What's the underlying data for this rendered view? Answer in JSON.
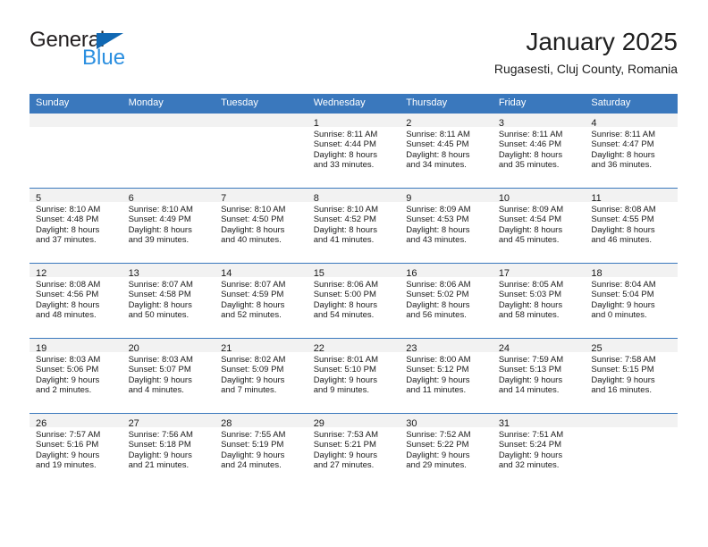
{
  "brand": {
    "name_top": "General",
    "name_bottom": "Blue",
    "triangle_color": "#1168b3",
    "blue_text_color": "#2b8fe0"
  },
  "header": {
    "title": "January 2025",
    "subtitle": "Rugasesti, Cluj County, Romania"
  },
  "theme": {
    "header_blue": "#3a78bd",
    "day_band_gray": "#f2f2f2",
    "text_color": "#1a1a1a"
  },
  "weekday_headers": [
    "Sunday",
    "Monday",
    "Tuesday",
    "Wednesday",
    "Thursday",
    "Friday",
    "Saturday"
  ],
  "weeks": [
    [
      {
        "day": "",
        "empty": true,
        "l1": "",
        "l2": "",
        "l3": "",
        "l4": ""
      },
      {
        "day": "",
        "empty": true,
        "l1": "",
        "l2": "",
        "l3": "",
        "l4": ""
      },
      {
        "day": "",
        "empty": true,
        "l1": "",
        "l2": "",
        "l3": "",
        "l4": ""
      },
      {
        "day": "1",
        "empty": false,
        "l1": "Sunrise: 8:11 AM",
        "l2": "Sunset: 4:44 PM",
        "l3": "Daylight: 8 hours",
        "l4": "and 33 minutes."
      },
      {
        "day": "2",
        "empty": false,
        "l1": "Sunrise: 8:11 AM",
        "l2": "Sunset: 4:45 PM",
        "l3": "Daylight: 8 hours",
        "l4": "and 34 minutes."
      },
      {
        "day": "3",
        "empty": false,
        "l1": "Sunrise: 8:11 AM",
        "l2": "Sunset: 4:46 PM",
        "l3": "Daylight: 8 hours",
        "l4": "and 35 minutes."
      },
      {
        "day": "4",
        "empty": false,
        "l1": "Sunrise: 8:11 AM",
        "l2": "Sunset: 4:47 PM",
        "l3": "Daylight: 8 hours",
        "l4": "and 36 minutes."
      }
    ],
    [
      {
        "day": "5",
        "empty": false,
        "l1": "Sunrise: 8:10 AM",
        "l2": "Sunset: 4:48 PM",
        "l3": "Daylight: 8 hours",
        "l4": "and 37 minutes."
      },
      {
        "day": "6",
        "empty": false,
        "l1": "Sunrise: 8:10 AM",
        "l2": "Sunset: 4:49 PM",
        "l3": "Daylight: 8 hours",
        "l4": "and 39 minutes."
      },
      {
        "day": "7",
        "empty": false,
        "l1": "Sunrise: 8:10 AM",
        "l2": "Sunset: 4:50 PM",
        "l3": "Daylight: 8 hours",
        "l4": "and 40 minutes."
      },
      {
        "day": "8",
        "empty": false,
        "l1": "Sunrise: 8:10 AM",
        "l2": "Sunset: 4:52 PM",
        "l3": "Daylight: 8 hours",
        "l4": "and 41 minutes."
      },
      {
        "day": "9",
        "empty": false,
        "l1": "Sunrise: 8:09 AM",
        "l2": "Sunset: 4:53 PM",
        "l3": "Daylight: 8 hours",
        "l4": "and 43 minutes."
      },
      {
        "day": "10",
        "empty": false,
        "l1": "Sunrise: 8:09 AM",
        "l2": "Sunset: 4:54 PM",
        "l3": "Daylight: 8 hours",
        "l4": "and 45 minutes."
      },
      {
        "day": "11",
        "empty": false,
        "l1": "Sunrise: 8:08 AM",
        "l2": "Sunset: 4:55 PM",
        "l3": "Daylight: 8 hours",
        "l4": "and 46 minutes."
      }
    ],
    [
      {
        "day": "12",
        "empty": false,
        "l1": "Sunrise: 8:08 AM",
        "l2": "Sunset: 4:56 PM",
        "l3": "Daylight: 8 hours",
        "l4": "and 48 minutes."
      },
      {
        "day": "13",
        "empty": false,
        "l1": "Sunrise: 8:07 AM",
        "l2": "Sunset: 4:58 PM",
        "l3": "Daylight: 8 hours",
        "l4": "and 50 minutes."
      },
      {
        "day": "14",
        "empty": false,
        "l1": "Sunrise: 8:07 AM",
        "l2": "Sunset: 4:59 PM",
        "l3": "Daylight: 8 hours",
        "l4": "and 52 minutes."
      },
      {
        "day": "15",
        "empty": false,
        "l1": "Sunrise: 8:06 AM",
        "l2": "Sunset: 5:00 PM",
        "l3": "Daylight: 8 hours",
        "l4": "and 54 minutes."
      },
      {
        "day": "16",
        "empty": false,
        "l1": "Sunrise: 8:06 AM",
        "l2": "Sunset: 5:02 PM",
        "l3": "Daylight: 8 hours",
        "l4": "and 56 minutes."
      },
      {
        "day": "17",
        "empty": false,
        "l1": "Sunrise: 8:05 AM",
        "l2": "Sunset: 5:03 PM",
        "l3": "Daylight: 8 hours",
        "l4": "and 58 minutes."
      },
      {
        "day": "18",
        "empty": false,
        "l1": "Sunrise: 8:04 AM",
        "l2": "Sunset: 5:04 PM",
        "l3": "Daylight: 9 hours",
        "l4": "and 0 minutes."
      }
    ],
    [
      {
        "day": "19",
        "empty": false,
        "l1": "Sunrise: 8:03 AM",
        "l2": "Sunset: 5:06 PM",
        "l3": "Daylight: 9 hours",
        "l4": "and 2 minutes."
      },
      {
        "day": "20",
        "empty": false,
        "l1": "Sunrise: 8:03 AM",
        "l2": "Sunset: 5:07 PM",
        "l3": "Daylight: 9 hours",
        "l4": "and 4 minutes."
      },
      {
        "day": "21",
        "empty": false,
        "l1": "Sunrise: 8:02 AM",
        "l2": "Sunset: 5:09 PM",
        "l3": "Daylight: 9 hours",
        "l4": "and 7 minutes."
      },
      {
        "day": "22",
        "empty": false,
        "l1": "Sunrise: 8:01 AM",
        "l2": "Sunset: 5:10 PM",
        "l3": "Daylight: 9 hours",
        "l4": "and 9 minutes."
      },
      {
        "day": "23",
        "empty": false,
        "l1": "Sunrise: 8:00 AM",
        "l2": "Sunset: 5:12 PM",
        "l3": "Daylight: 9 hours",
        "l4": "and 11 minutes."
      },
      {
        "day": "24",
        "empty": false,
        "l1": "Sunrise: 7:59 AM",
        "l2": "Sunset: 5:13 PM",
        "l3": "Daylight: 9 hours",
        "l4": "and 14 minutes."
      },
      {
        "day": "25",
        "empty": false,
        "l1": "Sunrise: 7:58 AM",
        "l2": "Sunset: 5:15 PM",
        "l3": "Daylight: 9 hours",
        "l4": "and 16 minutes."
      }
    ],
    [
      {
        "day": "26",
        "empty": false,
        "l1": "Sunrise: 7:57 AM",
        "l2": "Sunset: 5:16 PM",
        "l3": "Daylight: 9 hours",
        "l4": "and 19 minutes."
      },
      {
        "day": "27",
        "empty": false,
        "l1": "Sunrise: 7:56 AM",
        "l2": "Sunset: 5:18 PM",
        "l3": "Daylight: 9 hours",
        "l4": "and 21 minutes."
      },
      {
        "day": "28",
        "empty": false,
        "l1": "Sunrise: 7:55 AM",
        "l2": "Sunset: 5:19 PM",
        "l3": "Daylight: 9 hours",
        "l4": "and 24 minutes."
      },
      {
        "day": "29",
        "empty": false,
        "l1": "Sunrise: 7:53 AM",
        "l2": "Sunset: 5:21 PM",
        "l3": "Daylight: 9 hours",
        "l4": "and 27 minutes."
      },
      {
        "day": "30",
        "empty": false,
        "l1": "Sunrise: 7:52 AM",
        "l2": "Sunset: 5:22 PM",
        "l3": "Daylight: 9 hours",
        "l4": "and 29 minutes."
      },
      {
        "day": "31",
        "empty": false,
        "l1": "Sunrise: 7:51 AM",
        "l2": "Sunset: 5:24 PM",
        "l3": "Daylight: 9 hours",
        "l4": "and 32 minutes."
      },
      {
        "day": "",
        "empty": true,
        "l1": "",
        "l2": "",
        "l3": "",
        "l4": ""
      }
    ]
  ]
}
